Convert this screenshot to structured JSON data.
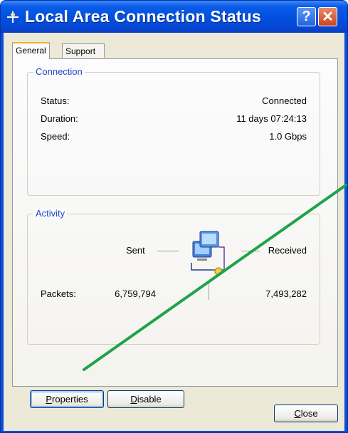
{
  "window": {
    "title": "Local Area Connection Status",
    "help_glyph": "?",
    "close_glyph": "✕"
  },
  "tabs": [
    {
      "label": "General",
      "active": true
    },
    {
      "label": "Support",
      "active": false
    }
  ],
  "connection": {
    "legend": "Connection",
    "rows": [
      {
        "label": "Status:",
        "value": "Connected"
      },
      {
        "label": "Duration:",
        "value": "11 days 07:24:13"
      },
      {
        "label": "Speed:",
        "value": "1.0 Gbps"
      }
    ]
  },
  "activity": {
    "legend": "Activity",
    "sent_label": "Sent",
    "received_label": "Received",
    "packets_label": "Packets:",
    "packets_sent": "6,759,794",
    "packets_received": "7,493,282",
    "icon": "network-computers-icon"
  },
  "buttons": {
    "properties": {
      "access_key": "P",
      "rest": "roperties"
    },
    "disable": {
      "access_key": "D",
      "rest": "isable"
    },
    "close": {
      "access_key": "C",
      "rest": "lose"
    }
  },
  "colors": {
    "titlebar": "#0052e0",
    "dialog_bg": "#ece9d8",
    "legend_text": "#1f46c8",
    "annotation_line": "#1fa34a"
  }
}
